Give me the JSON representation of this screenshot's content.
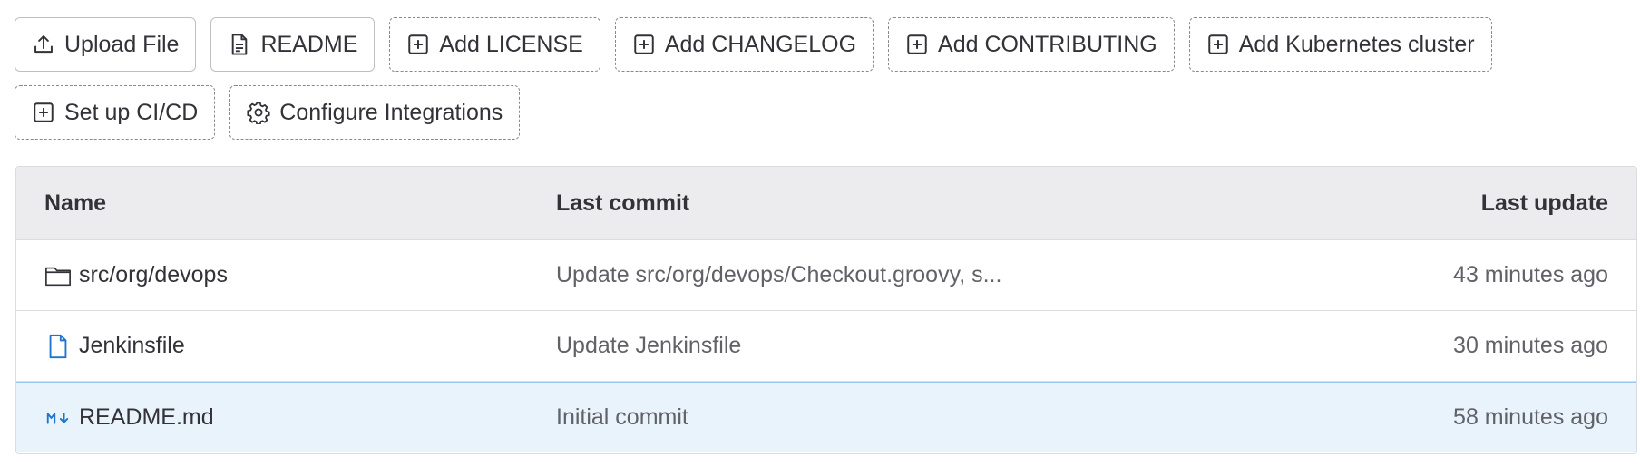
{
  "toolbar": {
    "row1": [
      {
        "label": "Upload File",
        "icon": "upload-icon",
        "style": "solid"
      },
      {
        "label": "README",
        "icon": "document-icon",
        "style": "solid"
      },
      {
        "label": "Add LICENSE",
        "icon": "plus-square-icon",
        "style": "dashed"
      },
      {
        "label": "Add CHANGELOG",
        "icon": "plus-square-icon",
        "style": "dashed"
      },
      {
        "label": "Add CONTRIBUTING",
        "icon": "plus-square-icon",
        "style": "dashed"
      },
      {
        "label": "Add Kubernetes cluster",
        "icon": "plus-square-icon",
        "style": "dashed"
      }
    ],
    "row2": [
      {
        "label": "Set up CI/CD",
        "icon": "plus-square-icon",
        "style": "dashed"
      },
      {
        "label": "Configure Integrations",
        "icon": "settings-icon",
        "style": "dashed"
      }
    ]
  },
  "table": {
    "headers": {
      "name": "Name",
      "last_commit": "Last commit",
      "last_update": "Last update"
    },
    "rows": [
      {
        "name": "src/org/devops",
        "icon": "folder-icon",
        "commit": "Update src/org/devops/Checkout.groovy, s...",
        "updated": "43 minutes ago"
      },
      {
        "name": "Jenkinsfile",
        "icon": "file-icon",
        "commit": "Update Jenkinsfile",
        "updated": "30 minutes ago"
      },
      {
        "name": "README.md",
        "icon": "markdown-icon",
        "commit": "Initial commit",
        "updated": "58 minutes ago"
      }
    ]
  },
  "colors": {
    "accent_blue": "#1f75cb",
    "selected_row": "#e9f3fc",
    "header_bg": "#ececef"
  }
}
